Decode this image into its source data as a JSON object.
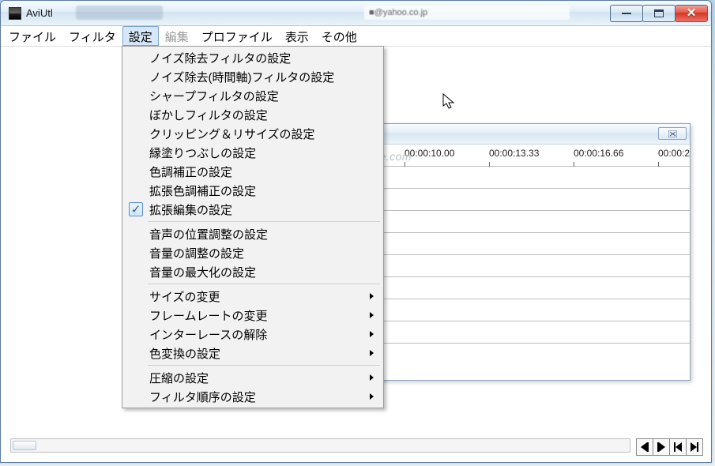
{
  "window": {
    "title": "AviUtl",
    "email_blur": "@yahoo.co.jp"
  },
  "menubar": {
    "items": [
      {
        "label": "ファイル"
      },
      {
        "label": "フィルタ"
      },
      {
        "label": "設定",
        "active": true
      },
      {
        "label": "編集",
        "disabled": true
      },
      {
        "label": "プロファイル"
      },
      {
        "label": "表示"
      },
      {
        "label": "その他"
      }
    ]
  },
  "dropdown": {
    "groups": [
      {
        "items": [
          {
            "label": "ノイズ除去フィルタの設定"
          },
          {
            "label": "ノイズ除去(時間軸)フィルタの設定"
          },
          {
            "label": "シャープフィルタの設定"
          },
          {
            "label": "ぼかしフィルタの設定"
          },
          {
            "label": "クリッピング＆リサイズの設定"
          },
          {
            "label": "縁塗りつぶしの設定"
          },
          {
            "label": "色調補正の設定"
          },
          {
            "label": "拡張色調補正の設定"
          },
          {
            "label": "拡張編集の設定",
            "checked": true
          }
        ]
      },
      {
        "items": [
          {
            "label": "音声の位置調整の設定"
          },
          {
            "label": "音量の調整の設定"
          },
          {
            "label": "音量の最大化の設定"
          }
        ]
      },
      {
        "items": [
          {
            "label": "サイズの変更",
            "submenu": true
          },
          {
            "label": "フレームレートの変更",
            "submenu": true
          },
          {
            "label": "インターレースの解除",
            "submenu": true
          },
          {
            "label": "色変換の設定",
            "submenu": true
          }
        ]
      },
      {
        "items": [
          {
            "label": "圧縮の設定",
            "submenu": true
          },
          {
            "label": "フィルタ順序の設定",
            "submenu": true
          }
        ]
      }
    ]
  },
  "timeline": {
    "ticks": [
      "00:00:10.00",
      "00:00:13.33",
      "00:00:16.66",
      "00:00:2"
    ],
    "track_count": 8
  },
  "watermark": "http://aonopage.com"
}
